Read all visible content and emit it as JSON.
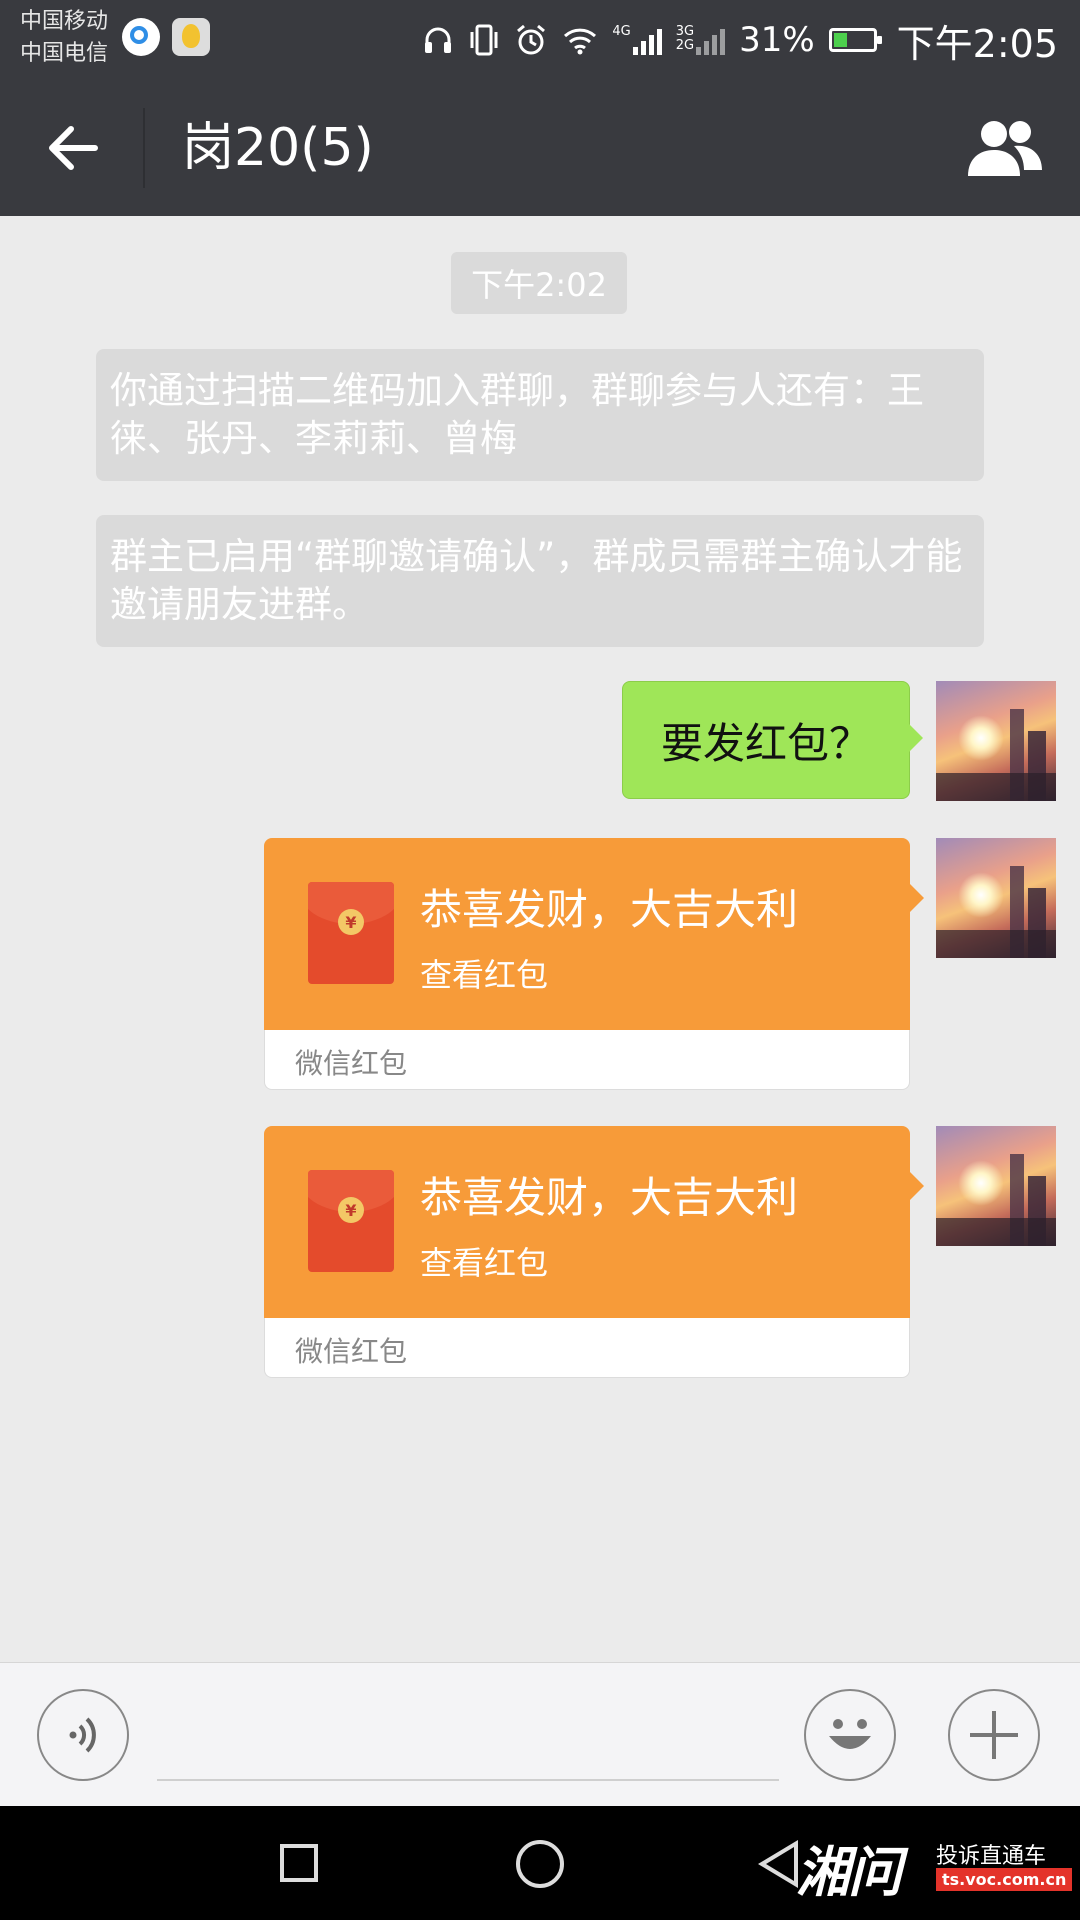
{
  "status_bar": {
    "carrier_1": "中国移动",
    "carrier_2": "中国电信",
    "net_4g": "4G",
    "net_3g": "3G",
    "net_2g": "2G",
    "battery_percent": "31%",
    "battery_level": 0.31,
    "time": "下午2:05",
    "icons": [
      "qq-browser-icon",
      "app-notification-icon",
      "headphones-icon",
      "vibrate-icon",
      "alarm-icon",
      "wifi-icon",
      "signal-icon",
      "battery-icon"
    ]
  },
  "header": {
    "title": "岗20(5)",
    "back_icon": "back-arrow-icon",
    "members_icon": "group-members-icon"
  },
  "chat": {
    "time_label": "下午2:02",
    "system_messages": [
      "你通过扫描二维码加入群聊，群聊参与人还有：王徕、张丹、李莉莉、曾梅",
      "群主已启用“群聊邀请确认”，群成员需群主确认才能邀请朋友进群。"
    ],
    "text_message": "要发红包？",
    "red_packets": [
      {
        "title": "恭喜发财，大吉大利",
        "subtitle": "查看红包",
        "source": "微信红包"
      },
      {
        "title": "恭喜发财，大吉大利",
        "subtitle": "查看红包",
        "source": "微信红包"
      }
    ],
    "coin_symbol": "¥"
  },
  "input_bar": {
    "placeholder": "",
    "voice_icon": "voice-input-icon",
    "emoji_icon": "emoji-icon",
    "plus_icon": "plus-icon"
  },
  "watermark": {
    "brand": "湘问",
    "tagline": "投诉直通车",
    "url": "ts.voc.com.cn"
  },
  "colors": {
    "bar": "#393a3f",
    "chat_bg": "#ebebeb",
    "green_bubble": "#9fe658",
    "red_packet": "#f79b39"
  }
}
